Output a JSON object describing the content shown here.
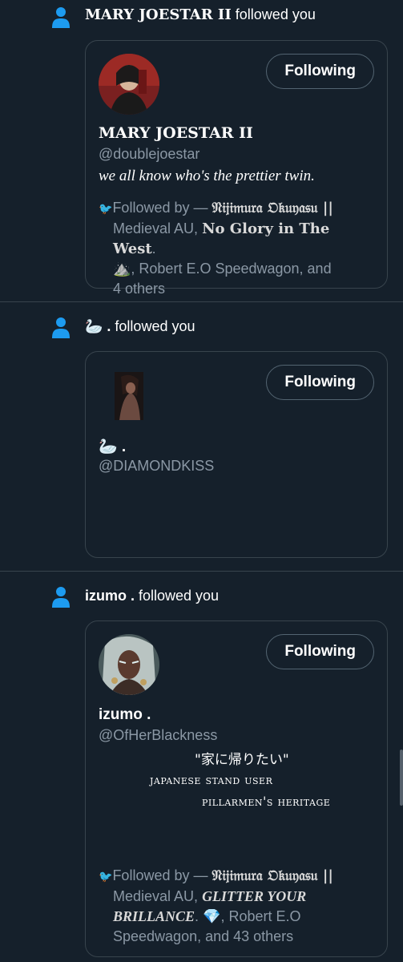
{
  "notifications": [
    {
      "display_name": "MARY JOESTAR II",
      "action_text": " followed you",
      "button_label": "Following",
      "card_name": "MARY JOESTAR II",
      "handle": "@doublejoestar",
      "bio": "we all know who's the prettier twin.",
      "followed_prefix": "Followed by — ",
      "followed_name1": "𝔑𝔦𝔧𝔦𝔪𝔲𝔯𝔞 𝔒𝔨𝔲𝔶𝔞𝔰𝔲 ||",
      "followed_line2a": "Medieval AU, ",
      "followed_line2b": "No Glory in The West",
      "followed_line2c": ".",
      "followed_line3": "⛰️, Robert E.O Speedwagon, and",
      "followed_line4": "4 others"
    },
    {
      "display_name": "🦢 .",
      "action_text": " followed you",
      "button_label": "Following",
      "card_name": "🦢 .",
      "handle": "@DIAMONDKISS"
    },
    {
      "display_name": "izumo .",
      "action_text": " followed you",
      "button_label": "Following",
      "card_name": "izumo .",
      "handle": "@OfHerBlackness",
      "bio_line1": "\"家に帰りたい\"",
      "bio_line2": "japanese stand user",
      "bio_line3": "pillarmen's heritage",
      "followed_prefix": "Followed by — ",
      "followed_name1": "𝔑𝔦𝔧𝔦𝔪𝔲𝔯𝔞 𝔒𝔨𝔲𝔶𝔞𝔰𝔲 ||",
      "followed_line2a": "Medieval AU, ",
      "followed_line2b": "GLITTER YOUR",
      "followed_line3a": "BRILLANCE",
      "followed_line3b": ". 💎, Robert E.O",
      "followed_line4": "Speedwagon, and 43 others"
    }
  ],
  "colors": {
    "background": "#15202b",
    "accent": "#1d9bf0",
    "secondary_text": "#8b98a5",
    "border": "#38444d"
  },
  "icons": [
    "person-icon",
    "bird-icon"
  ]
}
